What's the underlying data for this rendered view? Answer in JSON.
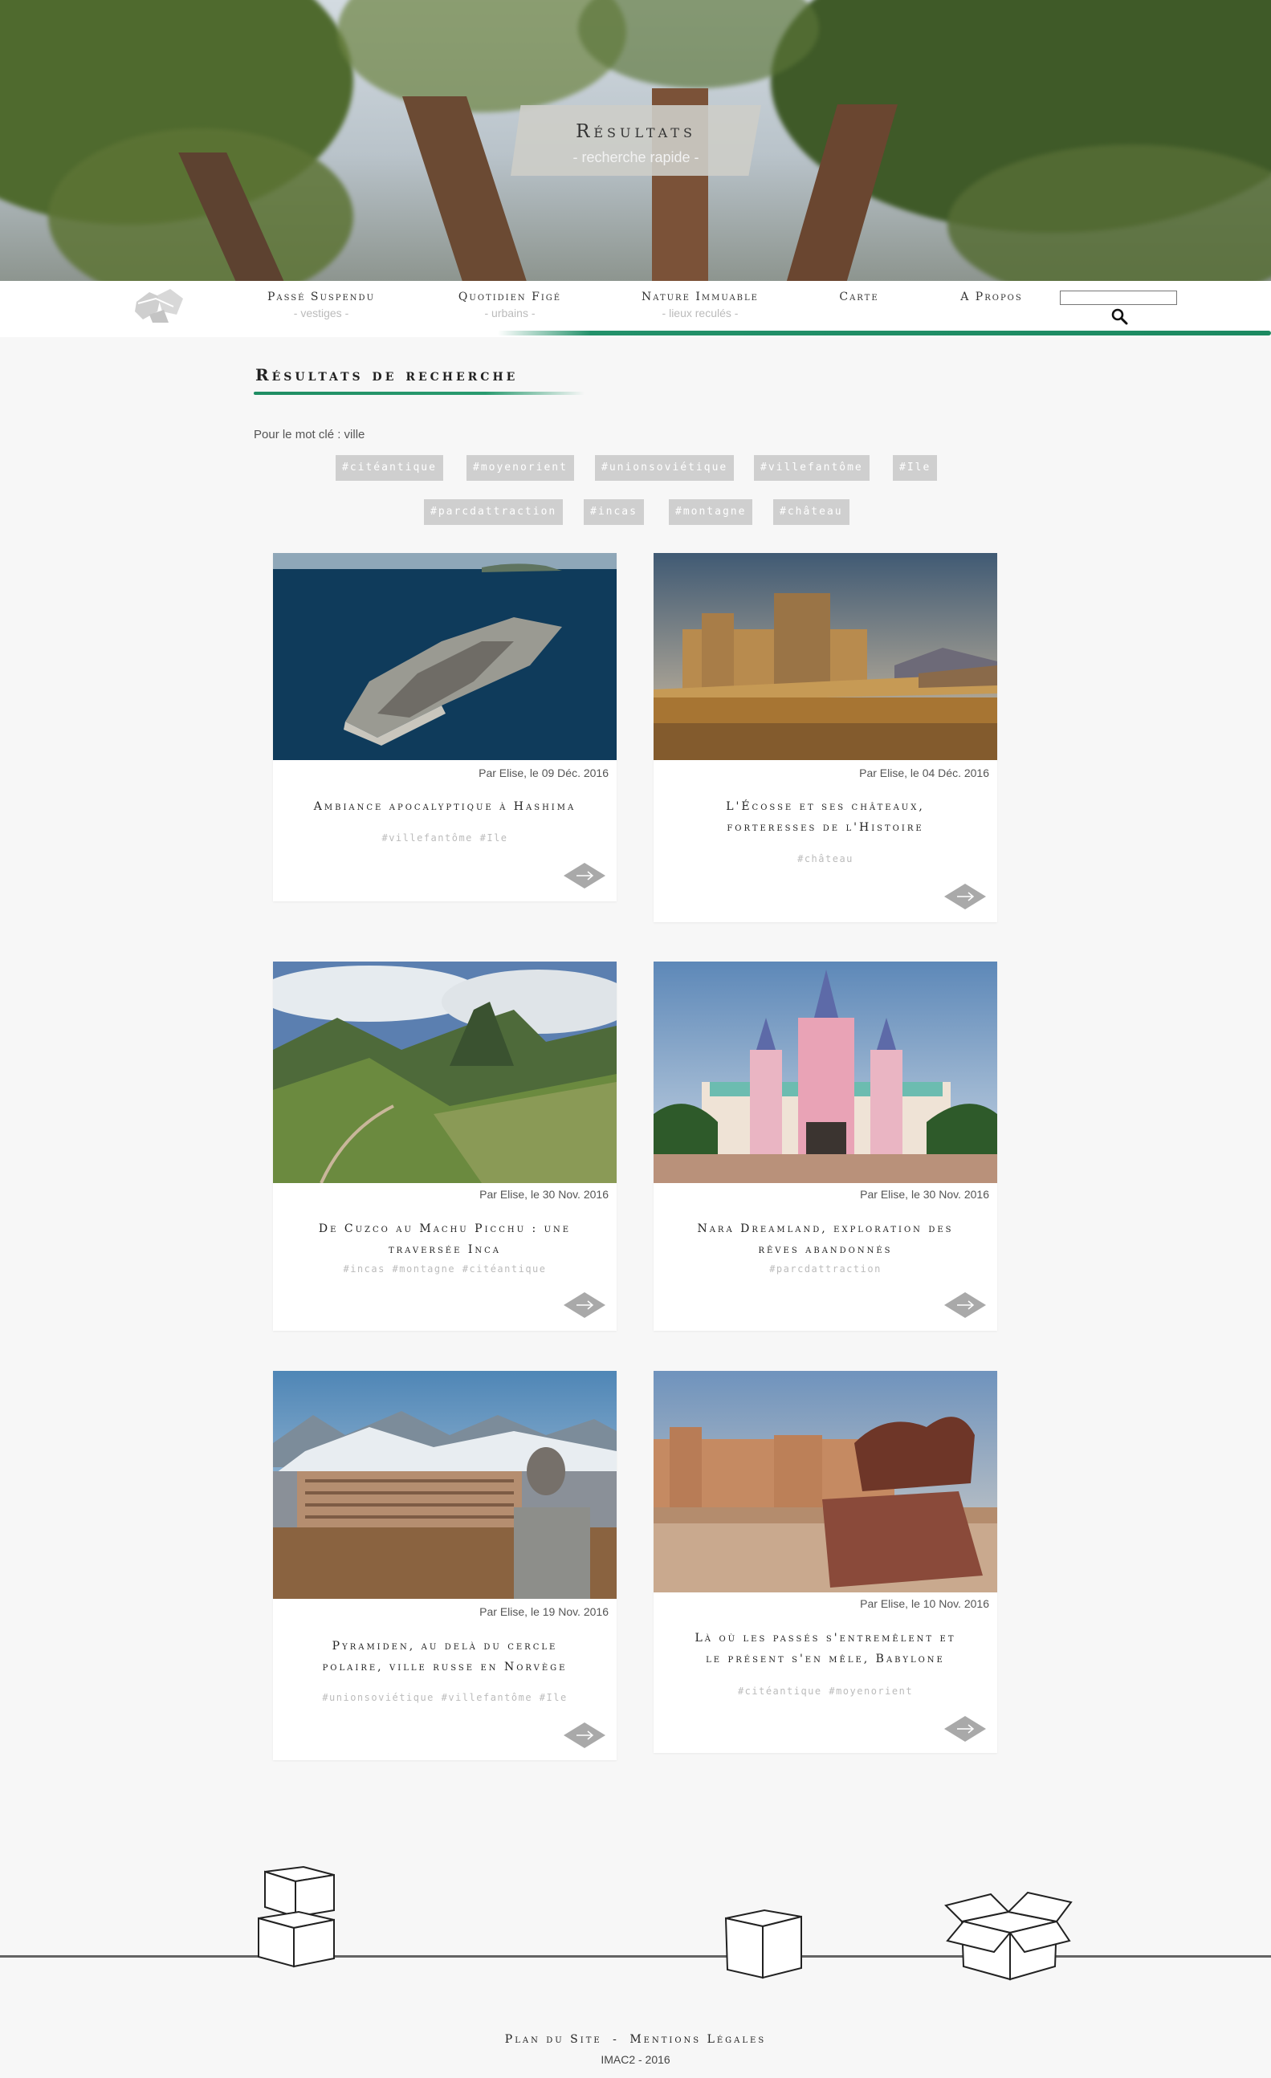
{
  "hero": {
    "title": "Résultats",
    "subtitle": "- recherche rapide -"
  },
  "nav": {
    "items": [
      {
        "label": "Passé Suspendu",
        "sub": "- vestiges -"
      },
      {
        "label": "Quotidien Figé",
        "sub": "- urbains -"
      },
      {
        "label": "Nature Immuable",
        "sub": "- lieux reculés -"
      },
      {
        "label": "Carte",
        "sub": ""
      },
      {
        "label": "A Propos",
        "sub": ""
      }
    ],
    "search_value": ""
  },
  "results": {
    "title": "Résultats de recherche",
    "keyword_line": "Pour le mot clé : ville",
    "tags": [
      "#citéantique",
      "#moyenorient",
      "#unionsoviétique",
      "#villefantôme",
      "#Ile",
      "#parcdattraction",
      "#incas",
      "#montagne",
      "#château"
    ]
  },
  "cards": [
    {
      "meta": "Par Elise, le 09 Déc. 2016",
      "title": "Ambiance apocalyptique à Hashima",
      "tags": "#villefantôme #Ile"
    },
    {
      "meta": "Par Elise, le 04 Déc. 2016",
      "title": "L'Écosse et ses châteaux, forteresses de l'Histoire",
      "tags": "#château"
    },
    {
      "meta": "Par Elise, le 30 Nov. 2016",
      "title": "De Cuzco au Machu Picchu : une traversée Inca",
      "tags": "#incas #montagne #citéantique"
    },
    {
      "meta": "Par Elise, le 30 Nov. 2016",
      "title": "Nara Dreamland, exploration des rêves abandonnés",
      "tags": "#parcdattraction"
    },
    {
      "meta": "Par Elise, le 19 Nov. 2016",
      "title": "Pyramiden, au delà du cercle polaire, ville russe en Norvège",
      "tags": "#unionsoviétique #villefantôme #Ile"
    },
    {
      "meta": "Par Elise, le 10 Nov. 2016",
      "title": "Là où les passés s'entremêlent et le présent s'en mêle, Babylone",
      "tags": "#citéantique #moyenorient"
    }
  ],
  "footer": {
    "plan": "Plan du Site",
    "separator": "-",
    "legal": "Mentions Légales",
    "copyright": "IMAC2 - 2016"
  },
  "colors": {
    "accent_green": "#1f8d63",
    "tag_bg": "#cfcfcf",
    "page_bg": "#f7f7f7"
  },
  "icons": [
    "logo-icon",
    "search-icon",
    "arrow-diamond-icon",
    "box-icon"
  ]
}
